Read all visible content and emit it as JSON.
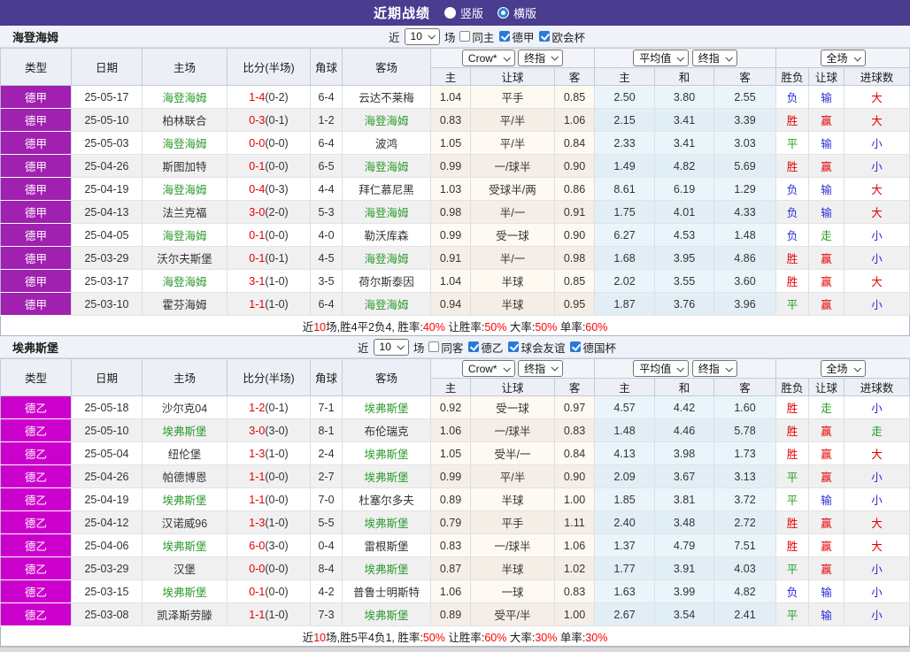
{
  "colors": {
    "topbar_bg": "#4A3C8F",
    "league_bundesliga1": "#A020B0",
    "league_bundesliga2": "#CC00CC",
    "team_highlight": "#2E9B2E",
    "red": "#E60000",
    "blue": "#2B2BD5",
    "green": "#1E9E1E",
    "summary_red": "#FF0000",
    "checkbox_blue": "#2979D9"
  },
  "topbar": {
    "title": "近期战绩",
    "modes": [
      {
        "label": "竖版",
        "selected": false
      },
      {
        "label": "横版",
        "selected": true
      }
    ]
  },
  "table_header": {
    "left_cols": [
      "类型",
      "日期",
      "主场",
      "比分(半场)",
      "角球",
      "客场"
    ],
    "odds_dropdowns": [
      "Crow*",
      "终指"
    ],
    "avg_dropdowns": [
      "平均值",
      "终指"
    ],
    "scope_dropdown": "全场",
    "sub_cols": [
      "主",
      "让球",
      "客",
      "主",
      "和",
      "客",
      "胜负",
      "让球",
      "进球数"
    ]
  },
  "sections": [
    {
      "team": "海登海姆",
      "type_color": "#A020B0",
      "filter": {
        "near_label": "近",
        "count": "10",
        "games_label": "场",
        "checkboxes": [
          {
            "label": "同主",
            "checked": false
          },
          {
            "label": "德甲",
            "checked": true
          },
          {
            "label": "欧会杯",
            "checked": true
          }
        ]
      },
      "rows": [
        {
          "type": "德甲",
          "date": "25-05-17",
          "home": "海登海姆",
          "home_hl": true,
          "score": "1-4",
          "half": "(0-2)",
          "corner": "6-4",
          "away": "云达不莱梅",
          "away_hl": false,
          "h": "1.04",
          "hc": "平手",
          "a": "0.85",
          "avg_h": "2.50",
          "avg_d": "3.80",
          "avg_a": "2.55",
          "res": "负",
          "hc_res": "输",
          "goal": "大"
        },
        {
          "type": "德甲",
          "date": "25-05-10",
          "home": "柏林联合",
          "home_hl": false,
          "score": "0-3",
          "half": "(0-1)",
          "corner": "1-2",
          "away": "海登海姆",
          "away_hl": true,
          "h": "0.83",
          "hc": "平/半",
          "a": "1.06",
          "avg_h": "2.15",
          "avg_d": "3.41",
          "avg_a": "3.39",
          "res": "胜",
          "hc_res": "赢",
          "goal": "大"
        },
        {
          "type": "德甲",
          "date": "25-05-03",
          "home": "海登海姆",
          "home_hl": true,
          "score": "0-0",
          "half": "(0-0)",
          "corner": "6-4",
          "away": "波鸿",
          "away_hl": false,
          "h": "1.05",
          "hc": "平/半",
          "a": "0.84",
          "avg_h": "2.33",
          "avg_d": "3.41",
          "avg_a": "3.03",
          "res": "平",
          "hc_res": "输",
          "goal": "小"
        },
        {
          "type": "德甲",
          "date": "25-04-26",
          "home": "斯图加特",
          "home_hl": false,
          "score": "0-1",
          "half": "(0-0)",
          "corner": "6-5",
          "away": "海登海姆",
          "away_hl": true,
          "h": "0.99",
          "hc": "一/球半",
          "a": "0.90",
          "avg_h": "1.49",
          "avg_d": "4.82",
          "avg_a": "5.69",
          "res": "胜",
          "hc_res": "赢",
          "goal": "小"
        },
        {
          "type": "德甲",
          "date": "25-04-19",
          "home": "海登海姆",
          "home_hl": true,
          "score": "0-4",
          "half": "(0-3)",
          "corner": "4-4",
          "away": "拜仁慕尼黑",
          "away_hl": false,
          "h": "1.03",
          "hc": "受球半/两",
          "a": "0.86",
          "avg_h": "8.61",
          "avg_d": "6.19",
          "avg_a": "1.29",
          "res": "负",
          "hc_res": "输",
          "goal": "大"
        },
        {
          "type": "德甲",
          "date": "25-04-13",
          "home": "法兰克福",
          "home_hl": false,
          "score": "3-0",
          "half": "(2-0)",
          "corner": "5-3",
          "away": "海登海姆",
          "away_hl": true,
          "h": "0.98",
          "hc": "半/一",
          "a": "0.91",
          "avg_h": "1.75",
          "avg_d": "4.01",
          "avg_a": "4.33",
          "res": "负",
          "hc_res": "输",
          "goal": "大"
        },
        {
          "type": "德甲",
          "date": "25-04-05",
          "home": "海登海姆",
          "home_hl": true,
          "score": "0-1",
          "half": "(0-0)",
          "corner": "4-0",
          "away": "勒沃库森",
          "away_hl": false,
          "h": "0.99",
          "hc": "受一球",
          "a": "0.90",
          "avg_h": "6.27",
          "avg_d": "4.53",
          "avg_a": "1.48",
          "res": "负",
          "hc_res": "走",
          "goal": "小"
        },
        {
          "type": "德甲",
          "date": "25-03-29",
          "home": "沃尔夫斯堡",
          "home_hl": false,
          "score": "0-1",
          "half": "(0-1)",
          "corner": "4-5",
          "away": "海登海姆",
          "away_hl": true,
          "h": "0.91",
          "hc": "半/一",
          "a": "0.98",
          "avg_h": "1.68",
          "avg_d": "3.95",
          "avg_a": "4.86",
          "res": "胜",
          "hc_res": "赢",
          "goal": "小"
        },
        {
          "type": "德甲",
          "date": "25-03-17",
          "home": "海登海姆",
          "home_hl": true,
          "score": "3-1",
          "half": "(1-0)",
          "corner": "3-5",
          "away": "荷尔斯泰因",
          "away_hl": false,
          "h": "1.04",
          "hc": "半球",
          "a": "0.85",
          "avg_h": "2.02",
          "avg_d": "3.55",
          "avg_a": "3.60",
          "res": "胜",
          "hc_res": "赢",
          "goal": "大"
        },
        {
          "type": "德甲",
          "date": "25-03-10",
          "home": "霍芬海姆",
          "home_hl": false,
          "score": "1-1",
          "half": "(1-0)",
          "corner": "6-4",
          "away": "海登海姆",
          "away_hl": true,
          "h": "0.94",
          "hc": "半球",
          "a": "0.95",
          "avg_h": "1.87",
          "avg_d": "3.76",
          "avg_a": "3.96",
          "res": "平",
          "hc_res": "赢",
          "goal": "小"
        }
      ],
      "summary": [
        {
          "t": "近",
          "r": false
        },
        {
          "t": "10",
          "r": true
        },
        {
          "t": "场,胜4平2负4, 胜率:",
          "r": false
        },
        {
          "t": "40%",
          "r": true
        },
        {
          "t": " 让胜率:",
          "r": false
        },
        {
          "t": "50%",
          "r": true
        },
        {
          "t": " 大率:",
          "r": false
        },
        {
          "t": "50%",
          "r": true
        },
        {
          "t": " 单率:",
          "r": false
        },
        {
          "t": "60%",
          "r": true
        }
      ]
    },
    {
      "team": "埃弗斯堡",
      "type_color": "#CC00CC",
      "filter": {
        "near_label": "近",
        "count": "10",
        "games_label": "场",
        "checkboxes": [
          {
            "label": "同客",
            "checked": false
          },
          {
            "label": "德乙",
            "checked": true
          },
          {
            "label": "球会友谊",
            "checked": true
          },
          {
            "label": "德国杯",
            "checked": true
          }
        ]
      },
      "rows": [
        {
          "type": "德乙",
          "date": "25-05-18",
          "home": "沙尔克04",
          "home_hl": false,
          "score": "1-2",
          "half": "(0-1)",
          "corner": "7-1",
          "away": "埃弗斯堡",
          "away_hl": true,
          "h": "0.92",
          "hc": "受一球",
          "a": "0.97",
          "avg_h": "4.57",
          "avg_d": "4.42",
          "avg_a": "1.60",
          "res": "胜",
          "hc_res": "走",
          "goal": "小"
        },
        {
          "type": "德乙",
          "date": "25-05-10",
          "home": "埃弗斯堡",
          "home_hl": true,
          "score": "3-0",
          "half": "(3-0)",
          "corner": "8-1",
          "away": "布伦瑞克",
          "away_hl": false,
          "h": "1.06",
          "hc": "一/球半",
          "a": "0.83",
          "avg_h": "1.48",
          "avg_d": "4.46",
          "avg_a": "5.78",
          "res": "胜",
          "hc_res": "赢",
          "goal": "走"
        },
        {
          "type": "德乙",
          "date": "25-05-04",
          "home": "纽伦堡",
          "home_hl": false,
          "score": "1-3",
          "half": "(1-0)",
          "corner": "2-4",
          "away": "埃弗斯堡",
          "away_hl": true,
          "h": "1.05",
          "hc": "受半/一",
          "a": "0.84",
          "avg_h": "4.13",
          "avg_d": "3.98",
          "avg_a": "1.73",
          "res": "胜",
          "hc_res": "赢",
          "goal": "大"
        },
        {
          "type": "德乙",
          "date": "25-04-26",
          "home": "帕德博恩",
          "home_hl": false,
          "score": "1-1",
          "half": "(0-0)",
          "corner": "2-7",
          "away": "埃弗斯堡",
          "away_hl": true,
          "h": "0.99",
          "hc": "平/半",
          "a": "0.90",
          "avg_h": "2.09",
          "avg_d": "3.67",
          "avg_a": "3.13",
          "res": "平",
          "hc_res": "赢",
          "goal": "小"
        },
        {
          "type": "德乙",
          "date": "25-04-19",
          "home": "埃弗斯堡",
          "home_hl": true,
          "score": "1-1",
          "half": "(0-0)",
          "corner": "7-0",
          "away": "杜塞尔多夫",
          "away_hl": false,
          "h": "0.89",
          "hc": "半球",
          "a": "1.00",
          "avg_h": "1.85",
          "avg_d": "3.81",
          "avg_a": "3.72",
          "res": "平",
          "hc_res": "输",
          "goal": "小"
        },
        {
          "type": "德乙",
          "date": "25-04-12",
          "home": "汉诺威96",
          "home_hl": false,
          "score": "1-3",
          "half": "(1-0)",
          "corner": "5-5",
          "away": "埃弗斯堡",
          "away_hl": true,
          "h": "0.79",
          "hc": "平手",
          "a": "1.11",
          "avg_h": "2.40",
          "avg_d": "3.48",
          "avg_a": "2.72",
          "res": "胜",
          "hc_res": "赢",
          "goal": "大"
        },
        {
          "type": "德乙",
          "date": "25-04-06",
          "home": "埃弗斯堡",
          "home_hl": true,
          "score": "6-0",
          "half": "(3-0)",
          "corner": "0-4",
          "away": "雷根斯堡",
          "away_hl": false,
          "h": "0.83",
          "hc": "一/球半",
          "a": "1.06",
          "avg_h": "1.37",
          "avg_d": "4.79",
          "avg_a": "7.51",
          "res": "胜",
          "hc_res": "赢",
          "goal": "大"
        },
        {
          "type": "德乙",
          "date": "25-03-29",
          "home": "汉堡",
          "home_hl": false,
          "score": "0-0",
          "half": "(0-0)",
          "corner": "8-4",
          "away": "埃弗斯堡",
          "away_hl": true,
          "h": "0.87",
          "hc": "半球",
          "a": "1.02",
          "avg_h": "1.77",
          "avg_d": "3.91",
          "avg_a": "4.03",
          "res": "平",
          "hc_res": "赢",
          "goal": "小"
        },
        {
          "type": "德乙",
          "date": "25-03-15",
          "home": "埃弗斯堡",
          "home_hl": true,
          "score": "0-1",
          "half": "(0-0)",
          "corner": "4-2",
          "away": "普鲁士明斯特",
          "away_hl": false,
          "h": "1.06",
          "hc": "一球",
          "a": "0.83",
          "avg_h": "1.63",
          "avg_d": "3.99",
          "avg_a": "4.82",
          "res": "负",
          "hc_res": "输",
          "goal": "小"
        },
        {
          "type": "德乙",
          "date": "25-03-08",
          "home": "凯泽斯劳滕",
          "home_hl": false,
          "score": "1-1",
          "half": "(1-0)",
          "corner": "7-3",
          "away": "埃弗斯堡",
          "away_hl": true,
          "h": "0.89",
          "hc": "受平/半",
          "a": "1.00",
          "avg_h": "2.67",
          "avg_d": "3.54",
          "avg_a": "2.41",
          "res": "平",
          "hc_res": "输",
          "goal": "小"
        }
      ],
      "summary": [
        {
          "t": "近",
          "r": false
        },
        {
          "t": "10",
          "r": true
        },
        {
          "t": "场,胜5平4负1, 胜率:",
          "r": false
        },
        {
          "t": "50%",
          "r": true
        },
        {
          "t": " 让胜率:",
          "r": false
        },
        {
          "t": "60%",
          "r": true
        },
        {
          "t": " 大率:",
          "r": false
        },
        {
          "t": "30%",
          "r": true
        },
        {
          "t": " 单率:",
          "r": false
        },
        {
          "t": "30%",
          "r": true
        }
      ]
    }
  ]
}
